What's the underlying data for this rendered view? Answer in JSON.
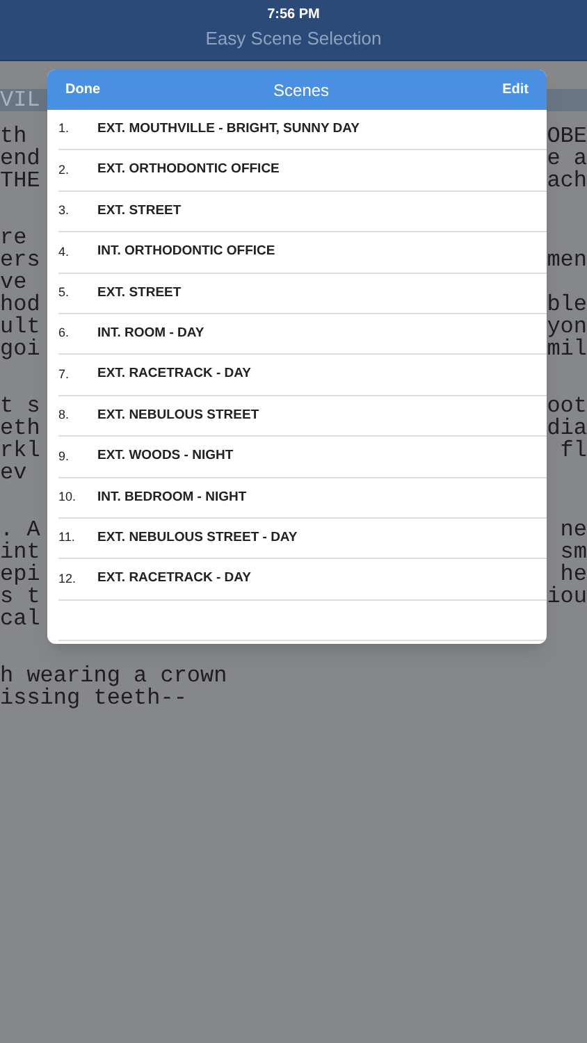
{
  "status_bar": {
    "time": "7:56 PM"
  },
  "nav_bar": {
    "title": "Easy Scene Selection"
  },
  "script_page": {
    "heading": "VIL",
    "paragraphs": [
      [
        {
          "left": "th",
          "right": "OBE"
        },
        {
          "left": "end",
          "right": "e a"
        },
        {
          "left": "THE",
          "right": "ach"
        }
      ],
      [
        {
          "left": "re"
        },
        {
          "left": "ers",
          "right": "men"
        },
        {
          "left": "ve"
        },
        {
          "left": "hod",
          "right": "ble"
        },
        {
          "left": "ult",
          "right": "yon"
        },
        {
          "left": "goi",
          "right": "mil"
        }
      ],
      [
        {
          "left": "t s",
          "right": "oot"
        },
        {
          "left": "eth",
          "right": "dia"
        },
        {
          "left": "rkl",
          "right": "fl"
        },
        {
          "left": "ev"
        }
      ],
      [
        {
          "left": ". A",
          "right": "ne"
        },
        {
          "left": "int",
          "right": "sm"
        },
        {
          "left": "epi",
          "right": "he"
        },
        {
          "left": "s t",
          "right": "iou"
        },
        {
          "left": "cal"
        }
      ],
      [
        {
          "left": "h wearing a crown"
        },
        {
          "left": "issing teeth--"
        }
      ]
    ]
  },
  "popover": {
    "title": "Scenes",
    "left_button": "Done",
    "right_button": "Edit",
    "scenes": [
      {
        "number": "1.",
        "heading": "EXT. MOUTHVILLE - BRIGHT, SUNNY DAY"
      },
      {
        "number": "2.",
        "heading": "EXT. ORTHODONTIC OFFICE"
      },
      {
        "number": "3.",
        "heading": "EXT. STREET"
      },
      {
        "number": "4.",
        "heading": "INT. ORTHODONTIC OFFICE"
      },
      {
        "number": "5.",
        "heading": "EXT. STREET"
      },
      {
        "number": "6.",
        "heading": "INT. ROOM - DAY"
      },
      {
        "number": "7.",
        "heading": "EXT. RACETRACK - DAY"
      },
      {
        "number": "8.",
        "heading": "EXT. NEBULOUS STREET"
      },
      {
        "number": "9.",
        "heading": "EXT. WOODS - NIGHT"
      },
      {
        "number": "10.",
        "heading": "INT. BEDROOM - NIGHT"
      },
      {
        "number": "11.",
        "heading": "EXT. NEBULOUS STREET - DAY"
      },
      {
        "number": "12.",
        "heading": "EXT. RACETRACK - DAY"
      }
    ]
  }
}
